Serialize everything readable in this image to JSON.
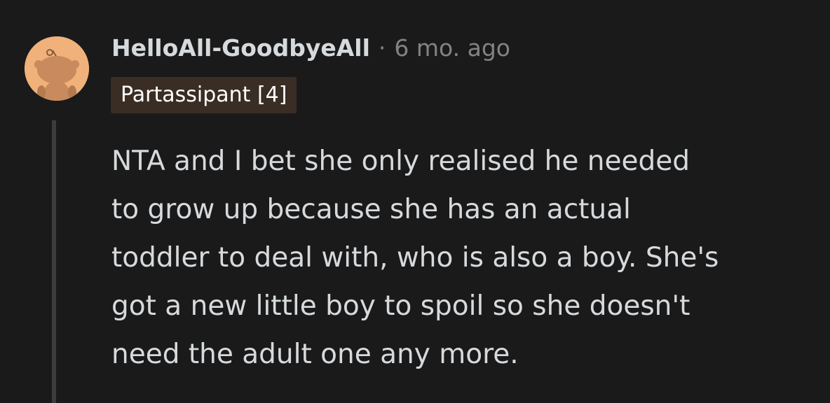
{
  "comment": {
    "author": "HelloAll-GoodbyeAll",
    "separator": "·",
    "timestamp": "6 mo. ago",
    "flair": "Partassipant [4]",
    "avatar_icon": "reddit-snoo-avatar-icon",
    "body_lines": [
      "NTA and I bet she only realised he needed",
      "to grow up because she has an actual",
      "toddler to deal with, who is also a boy. She's",
      "got a new little boy to spoil so she doesn't",
      "need the adult one any more."
    ]
  },
  "colors": {
    "background": "#1a1a1b",
    "text": "#d7dadc",
    "muted": "#818384",
    "avatar_bg": "#f0b27a",
    "flair_bg": "#3a2d24"
  }
}
